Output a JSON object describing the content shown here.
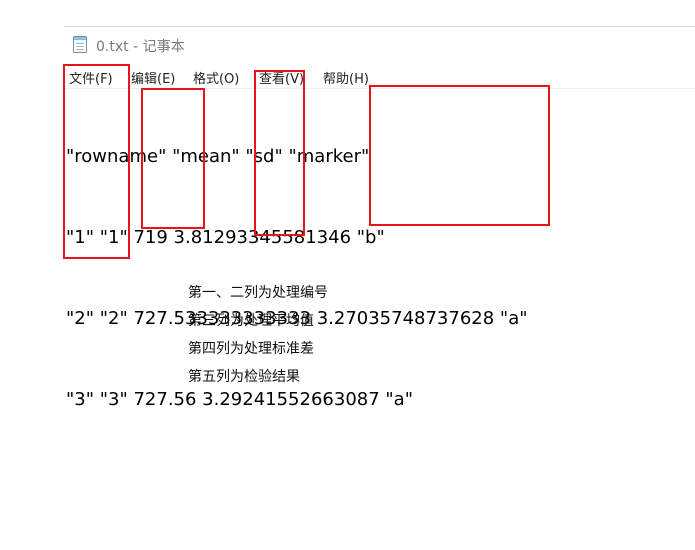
{
  "window": {
    "title": "0.txt - 记事本"
  },
  "menu": {
    "file": "文件(F)",
    "edit": "编辑(E)",
    "format": "格式(O)",
    "view": "查看(V)",
    "help": "帮助(H)"
  },
  "editor": {
    "lines": [
      "\"rowname\" \"mean\" \"sd\" \"marker\"",
      "\"1\" \"1\" 719 3.81293345581346 \"b\"",
      "\"2\" \"2\" 727.533333333333 3.27035748737628 \"a\"",
      "\"3\" \"3\" 727.56 3.29241552663087 \"a\""
    ]
  },
  "notes": {
    "lines": [
      "第一、二列为处理编号",
      "第三列为处理平均值",
      "第四列为处理标准差",
      "第五列为检验结果"
    ]
  },
  "colors": {
    "highlight_box": "#e8141b"
  }
}
